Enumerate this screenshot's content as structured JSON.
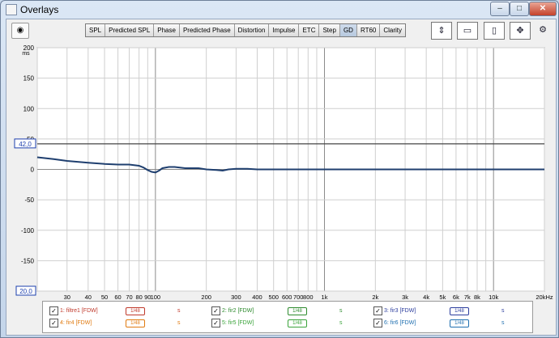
{
  "window": {
    "title": "Overlays",
    "buttons": {
      "minimize": "–",
      "maximize": "□",
      "close": "✕"
    }
  },
  "toolbar": {
    "tabs": [
      {
        "label": "SPL",
        "active": false
      },
      {
        "label": "Predicted SPL",
        "active": false
      },
      {
        "label": "Phase",
        "active": false
      },
      {
        "label": "Predicted Phase",
        "active": false
      },
      {
        "label": "Distortion",
        "active": false
      },
      {
        "label": "Impulse",
        "active": false
      },
      {
        "label": "ETC",
        "active": false
      },
      {
        "label": "Step",
        "active": false
      },
      {
        "label": "GD",
        "active": true
      },
      {
        "label": "RT60",
        "active": false
      },
      {
        "label": "Clarity",
        "active": false
      }
    ],
    "icons": [
      "capture-icon",
      "export-icon",
      "color-swatch-icon",
      "axis-limits-icon",
      "settings-gear-icon"
    ]
  },
  "chart_data": {
    "type": "line",
    "ylabel": "ms",
    "ylim": [
      -200,
      200
    ],
    "xlim": [
      20,
      20000
    ],
    "xscale": "log",
    "grid": true,
    "y_ticks": [
      "200",
      "150",
      "100",
      "50",
      "0",
      "-50",
      "-100",
      "-150",
      "-200"
    ],
    "x_ticks": [
      "20,0",
      "30",
      "40",
      "50",
      "60",
      "70",
      "80",
      "90",
      "100",
      "200",
      "300",
      "400",
      "500",
      "600",
      "700",
      "800",
      "1k",
      "2k",
      "3k",
      "4k",
      "5k",
      "6k",
      "7k",
      "8k",
      "10k",
      "20kHz"
    ],
    "cursor_y_label": "42,0",
    "cursor_y": 42,
    "cursor_x_label": "20,0",
    "series": [
      {
        "color": "#1f3f6f",
        "x": [
          20,
          25,
          30,
          40,
          50,
          60,
          70,
          80,
          85,
          90,
          95,
          100,
          105,
          110,
          120,
          130,
          150,
          180,
          200,
          230,
          250,
          270,
          300,
          350,
          400,
          500,
          700,
          1000,
          2000,
          5000,
          10000,
          20000
        ],
        "y": [
          20,
          17,
          14,
          11,
          9,
          8,
          8,
          6,
          3,
          -1,
          -4,
          -5,
          -2,
          2,
          4,
          4,
          2,
          2,
          0,
          -1,
          -2,
          0,
          1,
          1,
          0,
          0,
          0,
          0,
          0,
          0,
          0,
          0
        ]
      }
    ]
  },
  "legend": {
    "items": [
      {
        "index": "1:",
        "name": "filtre1 [FDW]",
        "color": "#c0392b",
        "glyph": "1/48",
        "unit": "s",
        "checked": true
      },
      {
        "index": "2:",
        "name": "fir2 [FDW]",
        "color": "#2e8b2e",
        "glyph": "1/48",
        "unit": "s",
        "checked": true
      },
      {
        "index": "3:",
        "name": "fir3 [FDW]",
        "color": "#2c3e9e",
        "glyph": "1/48",
        "unit": "s",
        "checked": true
      },
      {
        "index": "4:",
        "name": "fir4 [FDW]",
        "color": "#e07a10",
        "glyph": "1/48",
        "unit": "s",
        "checked": true
      },
      {
        "index": "5:",
        "name": "fir5 [FDW]",
        "color": "#3aa33a",
        "glyph": "1/48",
        "unit": "s",
        "checked": true
      },
      {
        "index": "6:",
        "name": "fir6 [FDW]",
        "color": "#1f6fb0",
        "glyph": "1/48",
        "unit": "s",
        "checked": true
      }
    ]
  }
}
